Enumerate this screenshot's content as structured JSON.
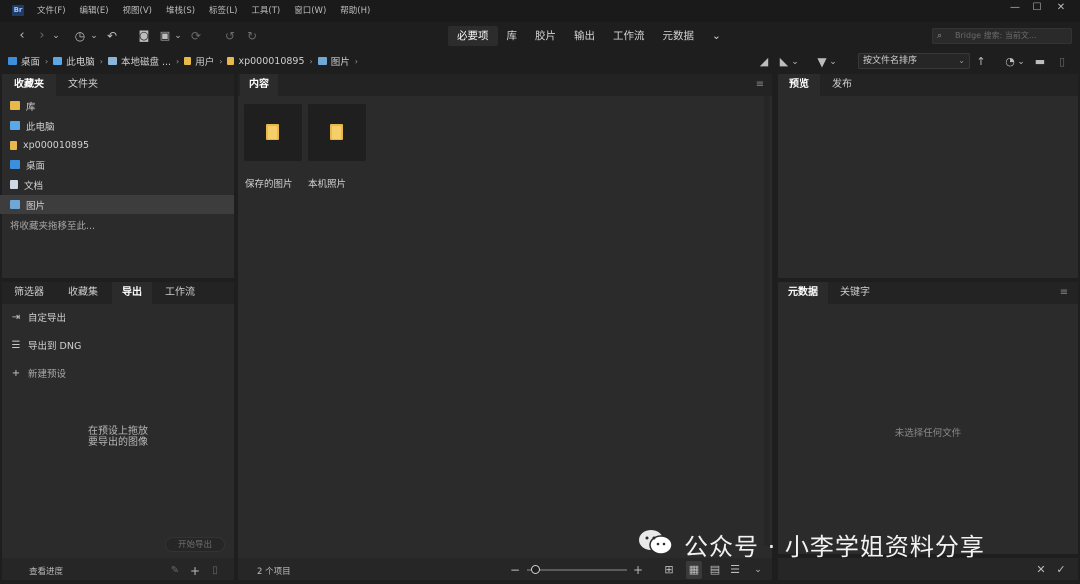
{
  "app": {
    "logo_text": "Br"
  },
  "menu": [
    "文件(F)",
    "编辑(E)",
    "视图(V)",
    "堆栈(S)",
    "标签(L)",
    "工具(T)",
    "窗口(W)",
    "帮助(H)"
  ],
  "window_controls": {
    "minimize": "—",
    "maximize": "☐",
    "close": "✕"
  },
  "workspaces": [
    {
      "label": "必要项",
      "active": true
    },
    {
      "label": "库",
      "active": false
    },
    {
      "label": "胶片",
      "active": false
    },
    {
      "label": "输出",
      "active": false
    },
    {
      "label": "工作流",
      "active": false
    },
    {
      "label": "元数据",
      "active": false
    }
  ],
  "workspace_more": "⌄",
  "search": {
    "placeholder": "Bridge 搜索: 当前文..."
  },
  "breadcrumb": [
    {
      "label": "桌面",
      "icon": "desktop-icon",
      "color": "#3b8fdc"
    },
    {
      "label": "此电脑",
      "icon": "computer-icon",
      "color": "#5aa9e6"
    },
    {
      "label": "本地磁盘 ...",
      "icon": "disk-icon",
      "color": "#8ab4d8"
    },
    {
      "label": "用户",
      "icon": "folder-icon",
      "color": "#e9b84a"
    },
    {
      "label": "xp000010895",
      "icon": "folder-icon",
      "color": "#e9b84a"
    },
    {
      "label": "图片",
      "icon": "pictures-icon",
      "color": "#6fa8d6"
    }
  ],
  "sort": {
    "value": "按文件名排序"
  },
  "favorites_panel": {
    "tabs": [
      {
        "label": "收藏夹",
        "active": true
      },
      {
        "label": "文件夹",
        "active": false
      }
    ],
    "items": [
      {
        "label": "库",
        "icon": "library-icon",
        "color": "#e9b84a",
        "selected": false
      },
      {
        "label": "此电脑",
        "icon": "computer-icon",
        "color": "#5aa9e6",
        "selected": false
      },
      {
        "label": "xp000010895",
        "icon": "folder-icon",
        "color": "#e9b84a",
        "selected": false
      },
      {
        "label": "桌面",
        "icon": "desktop-icon",
        "color": "#3b8fdc",
        "selected": false
      },
      {
        "label": "文档",
        "icon": "document-icon",
        "color": "#cfd8e3",
        "selected": false
      },
      {
        "label": "图片",
        "icon": "pictures-icon",
        "color": "#6fa8d6",
        "selected": true
      }
    ],
    "hint": "将收藏夹拖移至此..."
  },
  "export_panel": {
    "tabs": [
      {
        "label": "筛选器",
        "active": false
      },
      {
        "label": "收藏集",
        "active": false
      },
      {
        "label": "导出",
        "active": true
      },
      {
        "label": "工作流",
        "active": false
      }
    ],
    "items": [
      {
        "label": "自定导出",
        "icon": "export-icon",
        "glyph": "⇥"
      },
      {
        "label": "导出到 DNG",
        "icon": "list-icon",
        "glyph": "☰"
      },
      {
        "label": "新建预设",
        "icon": "plus-icon",
        "glyph": "+"
      }
    ],
    "drop_hint_line1": "在预设上拖放",
    "drop_hint_line2": "要导出的图像",
    "start_button": "开始导出",
    "view_progress": "查看进度"
  },
  "content_panel": {
    "tab": "内容",
    "items": [
      {
        "label": "保存的图片"
      },
      {
        "label": "本机照片"
      }
    ],
    "status": "2 个项目"
  },
  "preview_panel": {
    "tabs": [
      {
        "label": "预览",
        "active": true
      },
      {
        "label": "发布",
        "active": false
      }
    ]
  },
  "metadata_panel": {
    "tabs": [
      {
        "label": "元数据",
        "active": true
      },
      {
        "label": "关键字",
        "active": false
      }
    ],
    "empty": "未选择任何文件"
  },
  "watermark": {
    "text": "公众号 · 小李学姐资料分享"
  }
}
